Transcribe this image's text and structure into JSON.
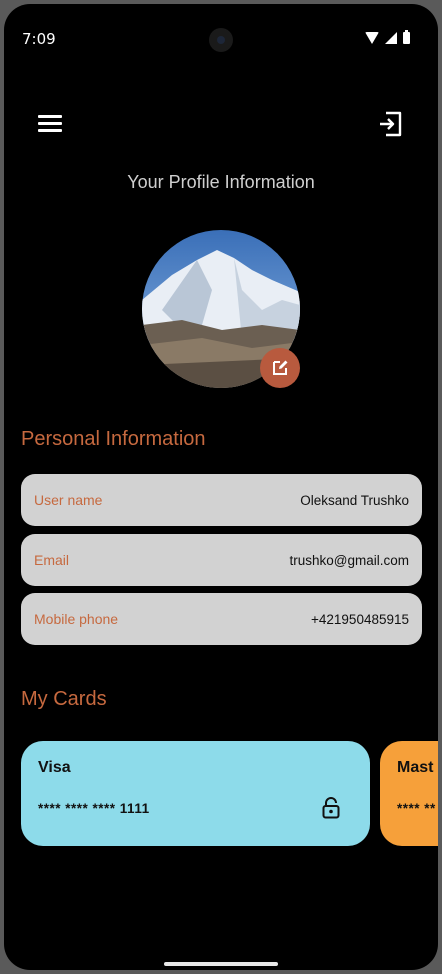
{
  "status_bar": {
    "time": "7:09"
  },
  "header": {
    "title": "Your Profile Information"
  },
  "icons": {
    "menu": "menu-icon",
    "logout": "logout-icon",
    "edit": "edit-icon",
    "lock": "lock-icon"
  },
  "personal": {
    "section_title": "Personal Information",
    "fields": [
      {
        "label": "User name",
        "value": "Oleksand Trushko"
      },
      {
        "label": "Email",
        "value": "trushko@gmail.com"
      },
      {
        "label": "Mobile phone",
        "value": "+421950485915"
      }
    ]
  },
  "cards": {
    "section_title": "My Cards",
    "items": [
      {
        "brand": "Visa",
        "number": "**** **** **** 1111",
        "color": "#8ddbea"
      },
      {
        "brand": "Mast",
        "number": "**** **",
        "color": "#f6a03a"
      }
    ]
  },
  "colors": {
    "accent": "#c6693f",
    "background": "#000000",
    "field_bg": "#d2d2d2",
    "edit_button": "#b85a3e"
  }
}
